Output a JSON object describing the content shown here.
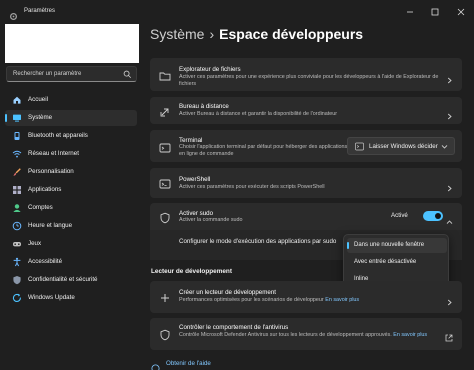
{
  "window": {
    "title": "Paramètres"
  },
  "sidebar": {
    "search_placeholder": "Rechercher un paramètre",
    "items": [
      {
        "label": "Accueil",
        "icon": "home-icon",
        "active": false
      },
      {
        "label": "Système",
        "icon": "system-icon",
        "active": true
      },
      {
        "label": "Bluetooth et appareils",
        "icon": "bluetooth-icon",
        "active": false
      },
      {
        "label": "Réseau et Internet",
        "icon": "wifi-icon",
        "active": false
      },
      {
        "label": "Personnalisation",
        "icon": "brush-icon",
        "active": false
      },
      {
        "label": "Applications",
        "icon": "apps-icon",
        "active": false
      },
      {
        "label": "Comptes",
        "icon": "account-icon",
        "active": false
      },
      {
        "label": "Heure et langue",
        "icon": "globe-clock-icon",
        "active": false
      },
      {
        "label": "Jeux",
        "icon": "gamepad-icon",
        "active": false
      },
      {
        "label": "Accessibilité",
        "icon": "accessibility-icon",
        "active": false
      },
      {
        "label": "Confidentialité et sécurité",
        "icon": "shield-icon",
        "active": false
      },
      {
        "label": "Windows Update",
        "icon": "update-icon",
        "active": false
      }
    ]
  },
  "breadcrumb": {
    "root": "Système",
    "current": "Espace développeurs"
  },
  "cards": {
    "explorer": {
      "title": "Explorateur de fichiers",
      "subtitle": "Activer ces paramètres pour une expérience plus conviviale pour les développeurs à l'aide de Explorateur de fichiers"
    },
    "remote": {
      "title": "Bureau à distance",
      "subtitle": "Activer Bureau à distance et garantir la disponibilité de l'ordinateur"
    },
    "terminal": {
      "title": "Terminal",
      "subtitle": "Choisir l'application terminal par défaut pour héberger des applications en ligne de commande",
      "dropdown_value": "Laisser Windows décider"
    },
    "powershell": {
      "title": "PowerShell",
      "subtitle": "Activer ces paramètres pour exécuter des scripts PowerShell"
    },
    "sudo": {
      "title": "Activer sudo",
      "subtitle": "Activer la commande sudo",
      "toggle_label": "Activé",
      "toggle_on": true,
      "config_label": "Configurer le mode d'exécution des applications par sudo"
    }
  },
  "sudo_menu": {
    "options": [
      "Dans une nouvelle fenêtre",
      "Avec entrée désactivée",
      "Inline"
    ],
    "selected": "Dans une nouvelle fenêtre"
  },
  "section": {
    "title": "Lecteur de développement"
  },
  "dev_drive": {
    "title": "Créer un lecteur de développement",
    "subtitle": "Performances optimisées pour les scénarios de développeur",
    "link": "En savoir plus"
  },
  "antivirus": {
    "title": "Contrôler le comportement de l'antivirus",
    "subtitle": "Contrôle Microsoft Defender Antivirus sur tous les lecteurs de développement approuvés.",
    "link": "En savoir plus"
  },
  "help": {
    "label": "Obtenir de l'aide"
  },
  "colors": {
    "accent": "#4cc2ff",
    "background": "#1f1f1f",
    "card": "#2b2b2b",
    "link": "#82c8ff"
  }
}
